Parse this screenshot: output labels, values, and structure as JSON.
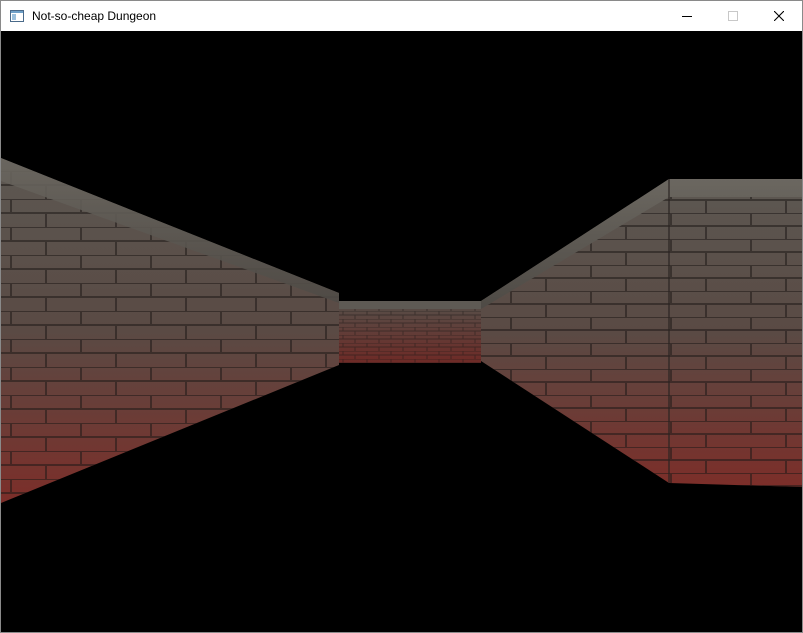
{
  "window": {
    "title": "Not-so-cheap Dungeon",
    "app_icon": "window-app-icon",
    "controls": [
      {
        "name": "minimize",
        "icon": "minimize-icon"
      },
      {
        "name": "maximize",
        "icon": "maximize-icon",
        "disabled": true
      },
      {
        "name": "close",
        "icon": "close-icon"
      }
    ]
  },
  "scene": {
    "description_type": "first-person dungeon corridor",
    "wall_texture": "stone-brick",
    "colors": {
      "background": "#000000",
      "wall_top": "#5a5650",
      "wall_bottom": "#7a2e28"
    }
  }
}
